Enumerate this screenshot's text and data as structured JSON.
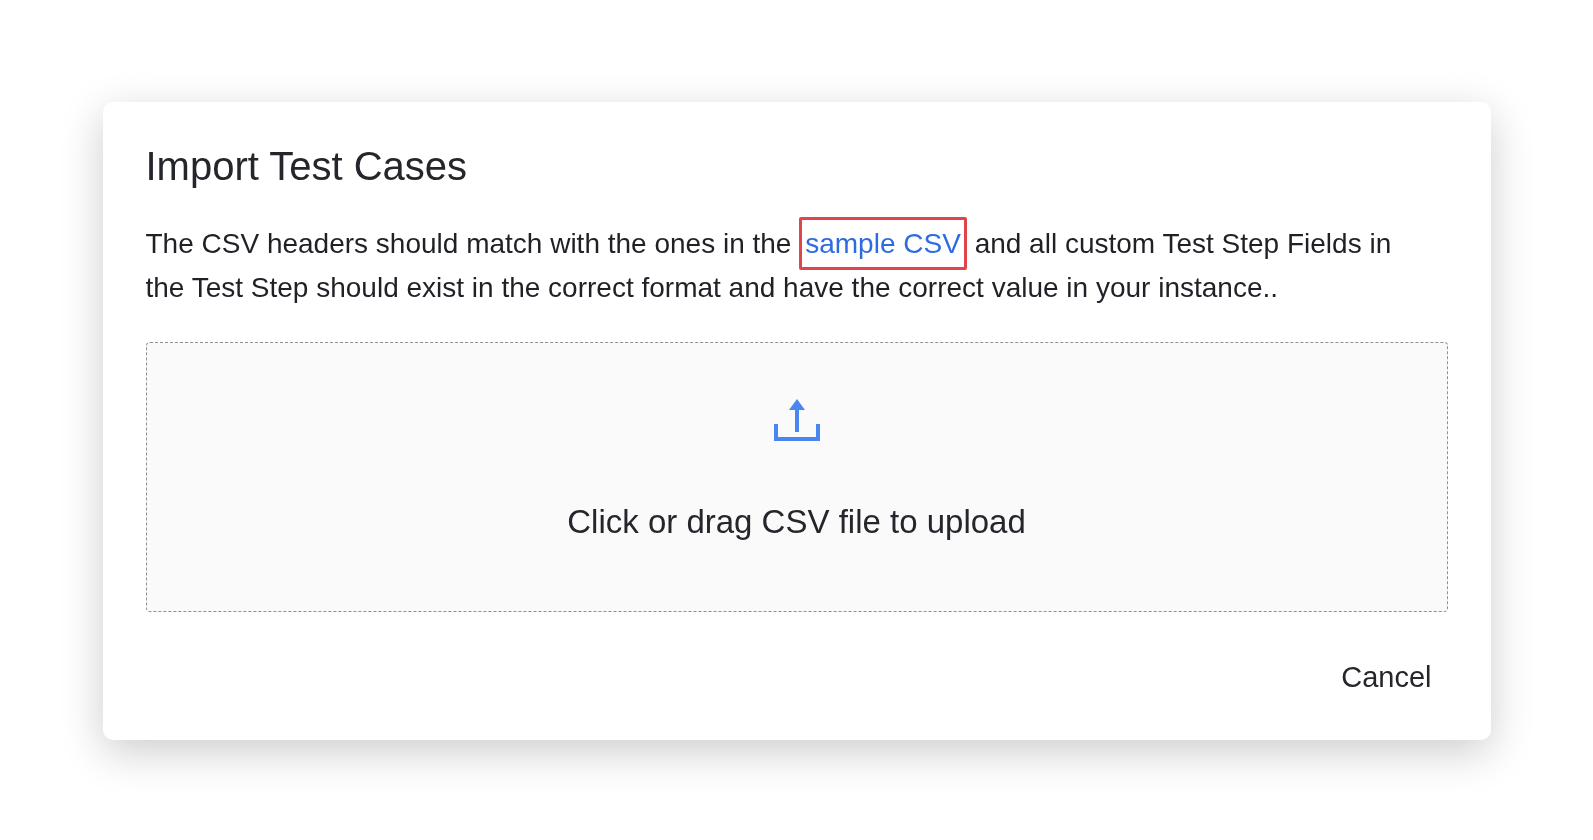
{
  "dialog": {
    "title": "Import Test Cases",
    "description": {
      "before": "The CSV headers should match with the ones in the",
      "link": {
        "text": "sample CSV",
        "highlighted": true
      },
      "after": "and all custom Test Step Fields in the Test Step should exist in the correct format and have the correct value in your instance.."
    },
    "upload_area": {
      "label": "Click or drag CSV file to upload"
    },
    "buttons": [
      {
        "label": "Cancel"
      }
    ]
  }
}
